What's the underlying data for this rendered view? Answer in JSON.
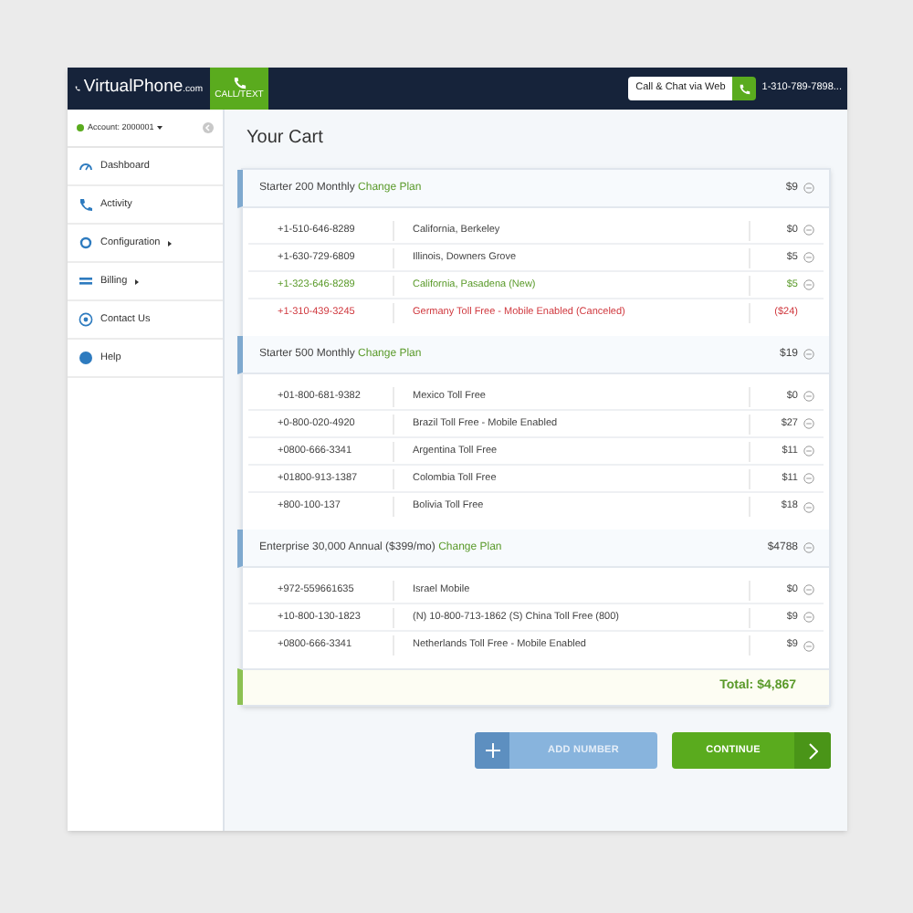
{
  "header": {
    "logo_main": "VirtualPhone",
    "logo_suffix": ".com",
    "call_tab": "CALL/TEXT",
    "web_button": "Call & Chat via Web",
    "phone": "1-310-789-7898..."
  },
  "sidebar": {
    "account": "Account: 2000001",
    "items": [
      {
        "label": "Dashboard",
        "submenu": false
      },
      {
        "label": "Activity",
        "submenu": false
      },
      {
        "label": "Configuration",
        "submenu": true
      },
      {
        "label": "Billing",
        "submenu": true
      },
      {
        "label": "Contact Us",
        "submenu": false
      },
      {
        "label": "Help",
        "submenu": false
      }
    ]
  },
  "title": "Your Cart",
  "plans": [
    {
      "name": "Starter 200 Monthly",
      "link": "Change Plan",
      "price": "$9",
      "rows": [
        {
          "number": "+1-510-646-8289",
          "description": "California, Berkeley",
          "price": "$0",
          "kind": "normal"
        },
        {
          "number": "+1-630-729-6809",
          "description": "Illinois, Downers Grove",
          "price": "$5",
          "kind": "normal"
        },
        {
          "number": "+1-323-646-8289",
          "description": "California, Pasadena (New)",
          "price": "$5",
          "kind": "new"
        },
        {
          "number": "+1-310-439-3245",
          "description": "Germany Toll Free - Mobile Enabled (Canceled)",
          "price": "($24)",
          "kind": "canceled"
        }
      ]
    },
    {
      "name": "Starter 500 Monthly",
      "link": "Change Plan",
      "price": "$19",
      "rows": [
        {
          "number": "+01-800-681-9382",
          "description": "Mexico Toll Free",
          "price": "$0",
          "kind": "normal"
        },
        {
          "number": "+0-800-020-4920",
          "description": "Brazil Toll Free - Mobile Enabled",
          "price": "$27",
          "kind": "normal"
        },
        {
          "number": "+0800-666-3341",
          "description": "Argentina Toll Free",
          "price": "$11",
          "kind": "normal"
        },
        {
          "number": "+01800-913-1387",
          "description": "Colombia Toll Free",
          "price": "$11",
          "kind": "normal"
        },
        {
          "number": "+800-100-137",
          "description": "Bolivia Toll Free",
          "price": "$18",
          "kind": "normal"
        }
      ]
    },
    {
      "name": "Enterprise 30,000 Annual ($399/mo)",
      "link": "Change Plan",
      "price": "$4788",
      "rows": [
        {
          "number": "+972-559661635",
          "description": "Israel Mobile",
          "price": "$0",
          "kind": "normal"
        },
        {
          "number": "+10-800-130-1823",
          "description": "(N) 10-800-713-1862 (S) China Toll Free (800)",
          "price": "$9",
          "kind": "normal"
        },
        {
          "number": "+0800-666-3341",
          "description": "Netherlands Toll Free - Mobile Enabled",
          "price": "$9",
          "kind": "normal"
        }
      ]
    }
  ],
  "total": "Total: $4,867",
  "buttons": {
    "add": "ADD NUMBER",
    "continue": "CONTINUE"
  }
}
